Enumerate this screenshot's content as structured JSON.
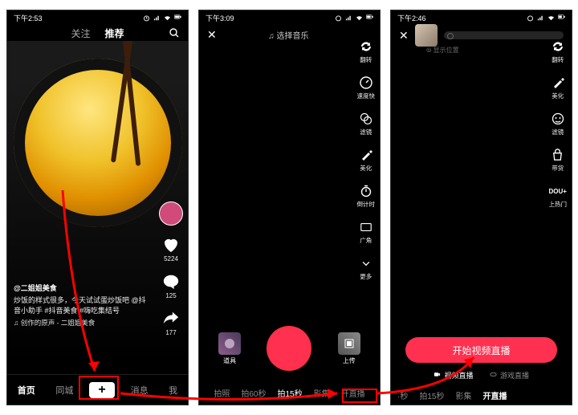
{
  "screen1": {
    "status_time": "下午2:53",
    "tab_follow": "关注",
    "tab_recommend": "推荐",
    "author": "@二姐姐美食",
    "caption": "炒饭的样式很多，今天试试蛋炒饭吧 @抖音小助手 #抖音美食 #嗨吃集结号",
    "music": "♫ 创作的原声 - 二姐姐美食",
    "likes": "5224",
    "comments": "125",
    "shares": "177",
    "nav": {
      "home": "首页",
      "city": "同城",
      "plus": "+",
      "msg": "消息",
      "me": "我"
    }
  },
  "screen2": {
    "status_time": "下午3:09",
    "music_select": "♫ 选择音乐",
    "tools": {
      "flip": "翻转",
      "speed": "速度快",
      "filter": "滤镜",
      "beauty": "美化",
      "timer": "倒计时",
      "flash": "广角",
      "more": "更多"
    },
    "left_thumb": "道具",
    "right_thumb": "上传",
    "modes": {
      "photo": "拍照",
      "s60": "拍60秒",
      "s15": "拍15秒",
      "album": "影集",
      "live": "开直播"
    }
  },
  "screen3": {
    "status_time": "下午2:46",
    "location": "⦾ 显示位置",
    "tools": {
      "flip": "翻转",
      "beauty": "美化",
      "filter": "滤镜",
      "goods": "带货",
      "douplus": "DOU+",
      "hot": "上热门"
    },
    "live_btn": "开始视频直播",
    "live_tab_video": "视频直播",
    "live_tab_game": "游戏直播",
    "modes": {
      "trunc": "·秒",
      "s15": "拍15秒",
      "album": "影集",
      "live": "开直播"
    }
  }
}
